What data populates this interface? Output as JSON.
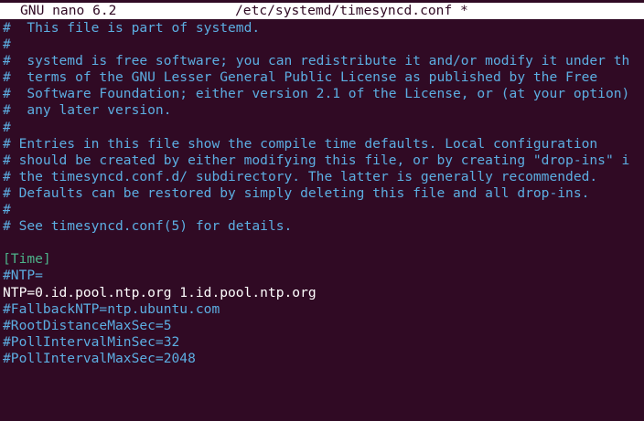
{
  "titlebar": {
    "app": "GNU nano 6.2",
    "file": "/etc/systemd/timesyncd.conf *"
  },
  "colors": {
    "background": "#300a24",
    "comment": "#5caee2",
    "section": "#4db38a",
    "text": "#ffffff",
    "titlebar_bg": "#ffffff"
  },
  "lines": [
    "#  This file is part of systemd.",
    "#",
    "#  systemd is free software; you can redistribute it and/or modify it under th",
    "#  terms of the GNU Lesser General Public License as published by the Free",
    "#  Software Foundation; either version 2.1 of the License, or (at your option)",
    "#  any later version.",
    "#",
    "# Entries in this file show the compile time defaults. Local configuration",
    "# should be created by either modifying this file, or by creating \"drop-ins\" i",
    "# the timesyncd.conf.d/ subdirectory. The latter is generally recommended.",
    "# Defaults can be restored by simply deleting this file and all drop-ins.",
    "#",
    "# See timesyncd.conf(5) for details.",
    "",
    "[Time]",
    "#NTP=",
    "NTP=0.id.pool.ntp.org 1.id.pool.ntp.org",
    "#FallbackNTP=ntp.ubuntu.com",
    "#RootDistanceMaxSec=5",
    "#PollIntervalMinSec=32",
    "#PollIntervalMaxSec=2048"
  ]
}
